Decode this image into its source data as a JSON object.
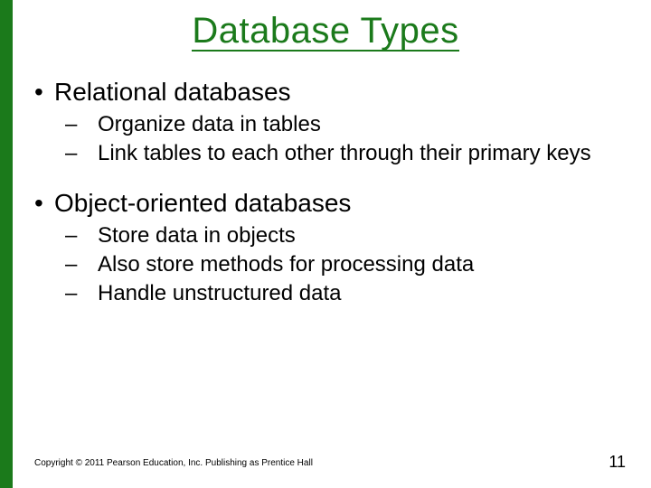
{
  "title": "Database Types",
  "bullets": {
    "b1": "Relational databases",
    "b1_1": "Organize data in tables",
    "b1_2": "Link tables to each other through their primary keys",
    "b2": "Object-oriented databases",
    "b2_1": "Store data in objects",
    "b2_2": "Also store methods for processing data",
    "b2_3": "Handle unstructured data"
  },
  "footer": {
    "copyright": "Copyright © 2011 Pearson Education, Inc. Publishing as Prentice Hall",
    "page": "11"
  }
}
